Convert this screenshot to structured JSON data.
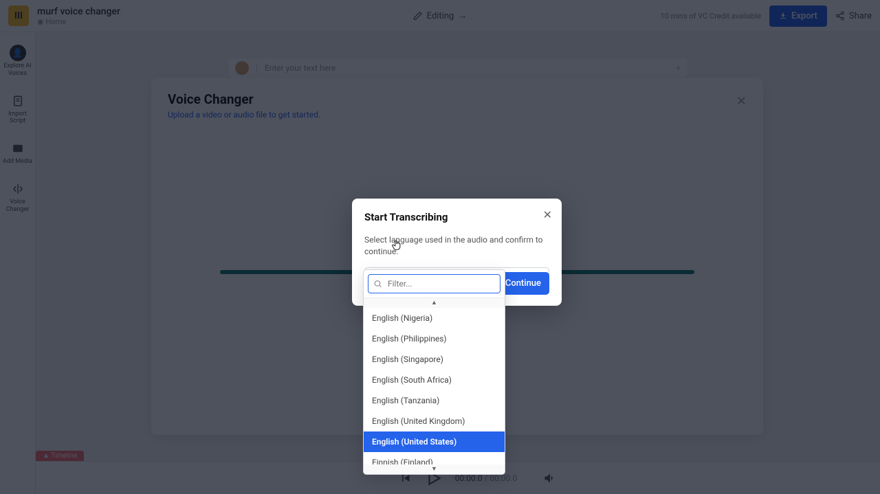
{
  "topbar": {
    "project_title": "murf voice changer",
    "project_sub": "◉ Home",
    "center_label": "Editing",
    "center_arrow": "→",
    "credits": "10 mins of VC Credit available",
    "export_label": "Export",
    "share_label": "Share"
  },
  "sidebar": {
    "items": [
      {
        "label": "Explore AI Voices"
      },
      {
        "label": "Import Script"
      },
      {
        "label": "Add Media"
      },
      {
        "label": "Voice Changer"
      }
    ]
  },
  "voice_block": {
    "placeholder": "Enter your text here"
  },
  "vc_card": {
    "title": "Voice Changer",
    "subtitle": "Upload a video or audio file to get started.",
    "close": "✕"
  },
  "playback": {
    "current": "00:00.0",
    "sep": " / ",
    "total": "00:00.0",
    "timeline_tab": "▲ Timeline"
  },
  "modal": {
    "title": "Start Transcribing",
    "subtitle": "Select language used in the audio and confirm to continue.",
    "selected_lang": "English (United States)",
    "continue_label": ", Continue",
    "close": "✕"
  },
  "dropdown": {
    "filter_placeholder": "Filter...",
    "options": [
      {
        "label": "English (Nigeria)",
        "selected": false
      },
      {
        "label": "English (Philippines)",
        "selected": false
      },
      {
        "label": "English (Singapore)",
        "selected": false
      },
      {
        "label": "English (South Africa)",
        "selected": false
      },
      {
        "label": "English (Tanzania)",
        "selected": false
      },
      {
        "label": "English (United Kingdom)",
        "selected": false
      },
      {
        "label": "English (United States)",
        "selected": true
      },
      {
        "label": "Finnish (Finland)",
        "selected": false
      }
    ]
  }
}
